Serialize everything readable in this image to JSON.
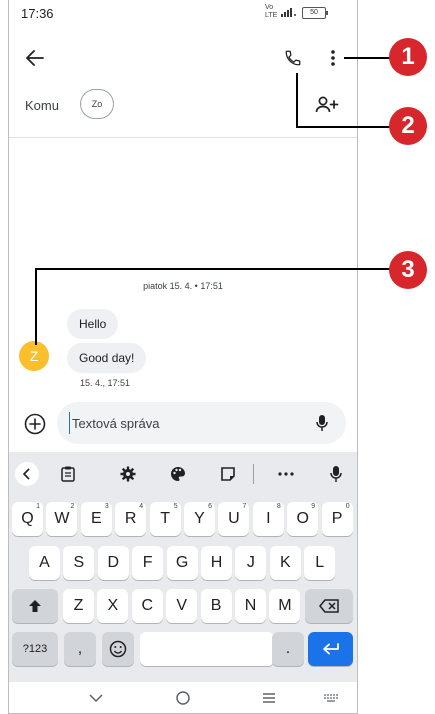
{
  "status_bar": {
    "time": "17:36",
    "signal_label": "Vo\nLTE",
    "battery": "50"
  },
  "header": {
    "back_icon": "back-arrow-icon",
    "call_icon": "phone-icon",
    "menu_icon": "more-vert-icon"
  },
  "recipient": {
    "label": "Komu",
    "chip": "Zo",
    "add_icon": "add-person-icon"
  },
  "conversation": {
    "date_separator": "piatok 15. 4. • 17:51",
    "messages": [
      {
        "text": "Hello"
      },
      {
        "text": "Good day!"
      }
    ],
    "avatar_letter": "Z",
    "timestamp": "15. 4., 17:51"
  },
  "compose": {
    "placeholder": "Textová správa"
  },
  "keyboard": {
    "row1": [
      {
        "k": "Q",
        "n": "1"
      },
      {
        "k": "W",
        "n": "2"
      },
      {
        "k": "E",
        "n": "3"
      },
      {
        "k": "R",
        "n": "4"
      },
      {
        "k": "T",
        "n": "5"
      },
      {
        "k": "Y",
        "n": "6"
      },
      {
        "k": "U",
        "n": "7"
      },
      {
        "k": "I",
        "n": "8"
      },
      {
        "k": "O",
        "n": "9"
      },
      {
        "k": "P",
        "n": "0"
      }
    ],
    "row2": [
      "A",
      "S",
      "D",
      "F",
      "G",
      "H",
      "J",
      "K",
      "L"
    ],
    "row3": [
      "Z",
      "X",
      "C",
      "V",
      "B",
      "N",
      "M"
    ],
    "symbols_label": "?123",
    "comma": ",",
    "period": ".",
    "accent_color": "#1a73e8"
  },
  "callouts": [
    "1",
    "2",
    "3"
  ],
  "colors": {
    "avatar": "#f9bf2c",
    "callout": "#d7262c",
    "bubble": "#eef0f3"
  }
}
